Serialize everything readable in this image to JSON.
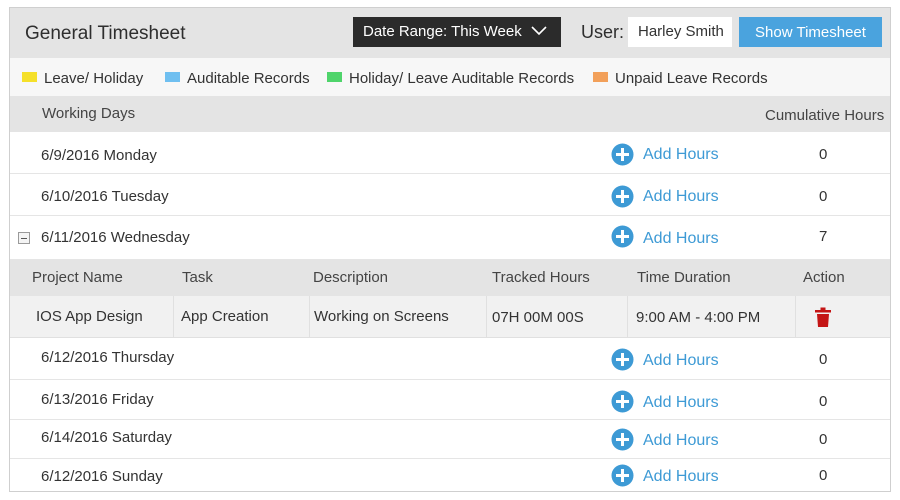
{
  "header": {
    "title": "General Timesheet",
    "date_range_label": "Date Range: This Week",
    "user_label": "User:",
    "user_value": "Harley Smith",
    "show_button": "Show Timesheet"
  },
  "legend": [
    {
      "label": "Leave/ Holiday",
      "color": "#f5e02a"
    },
    {
      "label": "Auditable Records",
      "color": "#6fbff0"
    },
    {
      "label": "Holiday/ Leave Auditable Records",
      "color": "#4fd46b"
    },
    {
      "label": "Unpaid Leave Records",
      "color": "#f2a05a"
    }
  ],
  "columns": {
    "working_days": "Working Days",
    "cumulative_hours": "Cumulative Hours"
  },
  "add_hours_label": "Add Hours",
  "days": [
    {
      "label": "6/9/2016 Monday",
      "hours": "0"
    },
    {
      "label": "6/10/2016 Tuesday",
      "hours": "0"
    },
    {
      "label": "6/11/2016 Wednesday",
      "hours": "7",
      "expanded": true
    },
    {
      "label": "6/12/2016 Thursday",
      "hours": "0"
    },
    {
      "label": "6/13/2016 Friday",
      "hours": "0"
    },
    {
      "label": "6/14/2016 Saturday",
      "hours": "0"
    },
    {
      "label": "6/12/2016 Sunday",
      "hours": "0"
    }
  ],
  "detail": {
    "headers": [
      "Project Name",
      "Task",
      "Description",
      "Tracked Hours",
      "Time Duration",
      "Action"
    ],
    "rows": [
      {
        "project": "IOS App Design",
        "task": "App Creation",
        "description": "Working on Screens",
        "tracked": "07H 00M 00S",
        "duration": "9:00 AM - 4:00 PM",
        "action_icon": "trash-icon"
      }
    ]
  },
  "colors": {
    "accent": "#4aa3de",
    "add_icon": "#3d9ad5",
    "delete": "#c41515",
    "dark_button": "#2b2b2b"
  }
}
